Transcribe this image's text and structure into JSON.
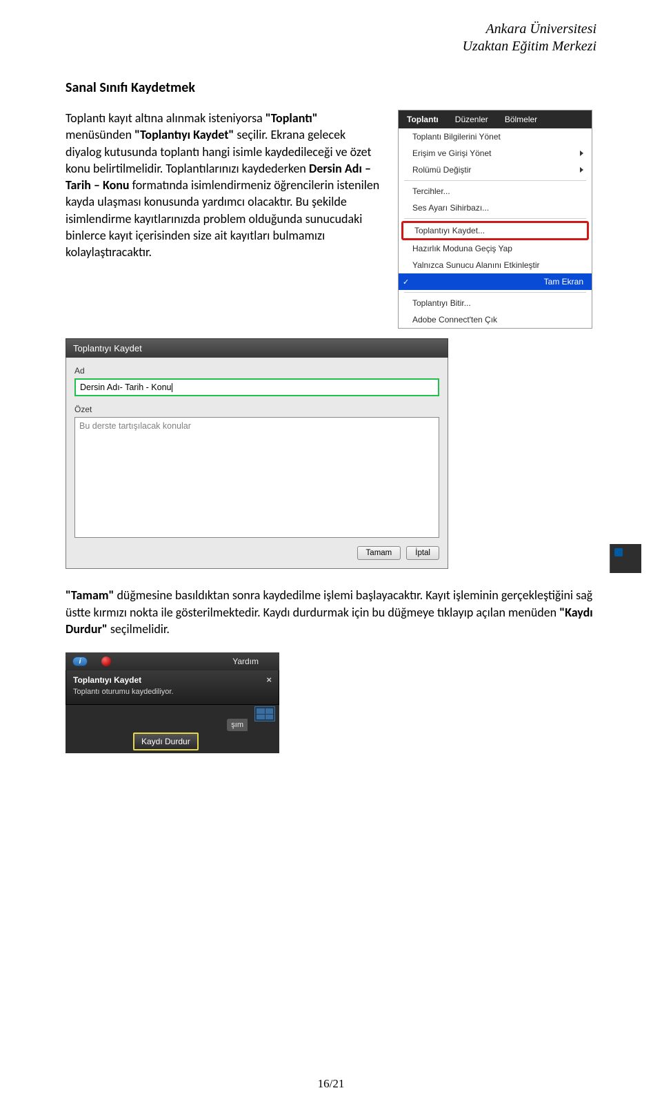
{
  "header": {
    "line1": "Ankara Üniversitesi",
    "line2": "Uzaktan Eğitim Merkezi"
  },
  "title": "Sanal Sınıfı Kaydetmek",
  "para1": {
    "p1a": "Toplantı kayıt altına alınmak isteniyorsa ",
    "p1b": "\"Toplantı\"",
    "p1c": " menüsünden ",
    "p1d": "\"Toplantıyı Kaydet\"",
    "p1e": " seçilir. Ekrana gelecek diyalog kutusunda toplantı hangi isimle kaydedileceği ve özet konu belirtilmelidir. Toplantılarınızı kaydederken ",
    "p1f": "Dersin Adı – Tarih – Konu",
    "p1g": " formatında isimlendirmeniz öğrencilerin istenilen kayda ulaşması konusunda yardımcı olacaktır. Bu şekilde isimlendirme kayıtlarınızda problem olduğunda sunucudaki binlerce kayıt içerisinden size ait kayıtları bulmamızı kolaylaştıracaktır."
  },
  "menu": {
    "tabs": {
      "toplanti": "Toplantı",
      "duzenler": "Düzenler",
      "bolmeler": "Bölmeler"
    },
    "items": {
      "bilgi": "Toplantı Bilgilerini Yönet",
      "erisim": "Erişim ve Girişi Yönet",
      "rolumu": "Rolümü Değiştir",
      "tercihler": "Tercihler...",
      "ses": "Ses Ayarı Sihirbazı...",
      "kaydet": "Toplantıyı Kaydet...",
      "hazirlik": "Hazırlık Moduna Geçiş Yap",
      "sunucu": "Yalnızca Sunucu Alanını Etkinleştir",
      "tam": "Tam Ekran",
      "bitir": "Toplantıyı Bitir...",
      "cik": "Adobe Connect'ten Çık"
    }
  },
  "dialog": {
    "title": "Toplantıyı Kaydet",
    "label_ad": "Ad",
    "input_ad": "Dersin Adı- Tarih - Konu",
    "label_ozet": "Özet",
    "placeholder_ozet": "Bu derste tartışılacak konular",
    "btn_ok": "Tamam",
    "btn_cancel": "İptal"
  },
  "para2": {
    "p2a": "\"Tamam\"",
    "p2b": " düğmesine basıldıktan sonra kaydedilme işlemi başlayacaktır. Kayıt işleminin gerçekleştiğini sağ üstte kırmızı nokta ile gösterilmektedir. Kaydı durdurmak için bu düğmeye tıklayıp açılan menüden ",
    "p2c": "\"Kaydı Durdur\"",
    "p2d": " seçilmelidir."
  },
  "rec": {
    "help": "Yardım",
    "tooltip_title": "Toplantıyı Kaydet",
    "tooltip_sub": "Toplantı oturumu kaydediliyor.",
    "tag": "şım",
    "stop": "Kaydı Durdur",
    "info_char": "i"
  },
  "page": "16/21",
  "checkmark": "✓"
}
